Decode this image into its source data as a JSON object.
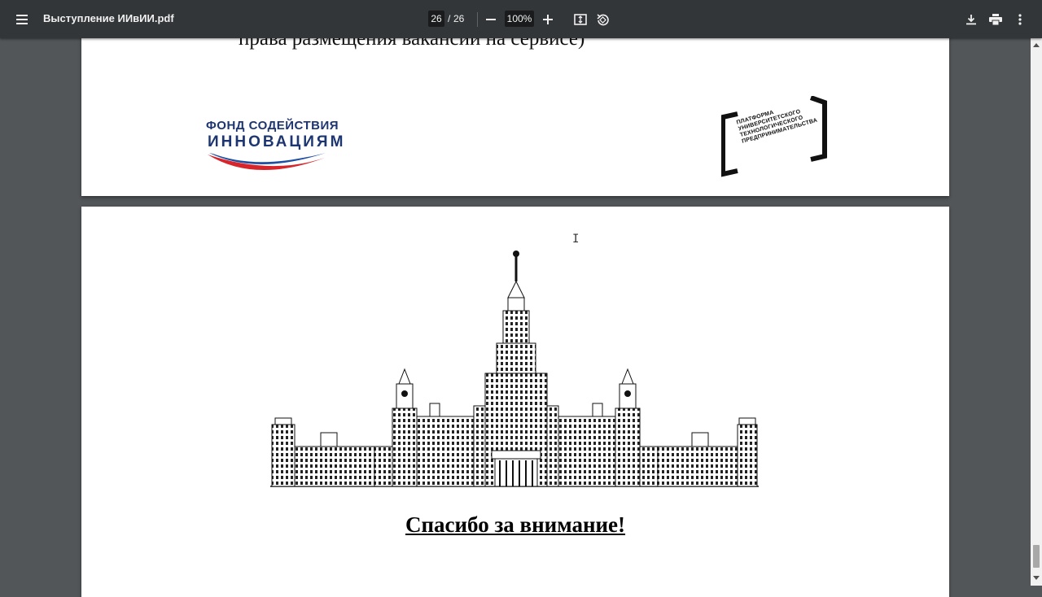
{
  "toolbar": {
    "title": "Выступление ИИвИИ.pdf",
    "current_page": "26",
    "page_separator": "/",
    "total_pages": "26",
    "zoom": "100%",
    "icons": [
      "menu-icon",
      "zoom-out-icon",
      "zoom-in-icon",
      "fit-page-icon",
      "rotate-icon",
      "download-icon",
      "print-icon",
      "more-icon"
    ]
  },
  "page1": {
    "cut_text": "права размещения вакансии на сервисе)",
    "logo_fund": {
      "line1": "ФОНД СОДЕЙСТВИЯ",
      "line2": "ИННОВАЦИЯМ",
      "swoosh_colors": [
        "#1f4fa3",
        "#ffffff",
        "#d6262b"
      ]
    },
    "logo_platform": {
      "lines": [
        "ПЛАТФОРМА",
        "УНИВЕРСИТЕТСКОГО",
        "ТЕХНОЛОГИЧЕСКОГО",
        "ПРЕДПРИНИМАТЕЛЬСТВА"
      ]
    }
  },
  "page2": {
    "illustration": "msu-building-drawing",
    "thanks_text": "Спасибо за внимание!"
  },
  "colors": {
    "toolbar_bg": "#323639",
    "viewer_bg": "#525659",
    "page_bg": "#ffffff"
  }
}
